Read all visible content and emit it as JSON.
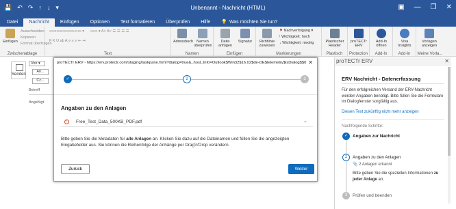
{
  "titlebar": {
    "title": "Unbenannt - Nachricht (HTML)",
    "qat": [
      "💾",
      "↶",
      "↷",
      "↑",
      "↓",
      "▾"
    ],
    "window_controls": [
      "▣",
      "—",
      "❐",
      "✕"
    ]
  },
  "tabs": [
    {
      "label": "Datei"
    },
    {
      "label": "Nachricht"
    },
    {
      "label": "Einfügen"
    },
    {
      "label": "Optionen"
    },
    {
      "label": "Text formatieren"
    },
    {
      "label": "Überprüfen"
    },
    {
      "label": "Hilfe"
    }
  ],
  "tell_me": "Was möchten Sie tun?",
  "ribbon": {
    "clipboard": {
      "paste": "Einfügen",
      "cut": "Ausschneiden",
      "copy": "Kopieren",
      "format": "Format übertragen",
      "label": "Zwischenablage"
    },
    "text_label": "Text",
    "names": {
      "addressbook": "Adressbuch",
      "check": "Namen überprüfen",
      "label": "Namen"
    },
    "include": {
      "attach": "Datei anfügen",
      "signature": "Signatur",
      "label": "Einfügen"
    },
    "tags": {
      "policy": "Richtlinie zuweisen",
      "followup": "Nachverfolgung",
      "high": "Wichtigkeit: hoch",
      "low": "Wichtigkeit: niedrig",
      "label": "Markierungen"
    },
    "addins": [
      {
        "label": "Plastischer Reader",
        "group": "Plastisch"
      },
      {
        "label": "proTECTr ERV",
        "group": "Protection"
      },
      {
        "label": "Add-In öffnen",
        "group": "Add-In"
      },
      {
        "label": "Viva Insights",
        "group": "Add-In"
      },
      {
        "label": "Vorlagen anzeigen",
        "group": "Meine Vorla..."
      }
    ]
  },
  "compose": {
    "send": "Senden",
    "from": "Von",
    "to": "An...",
    "cc": "Cc...",
    "subject": "Betreff",
    "attached": "Angefügt"
  },
  "dialog": {
    "title": "proTECTr ERV - https://erv.protectr.com/staging/taskpane.html?dialog=true&_host_Info=Outlook$Win32$16.02$de-DE$telemetry$isDialog$$0",
    "close": "✕",
    "steps": [
      {
        "label": "✓",
        "state": "done"
      },
      {
        "label": "2",
        "state": "current"
      },
      {
        "label": "3",
        "state": "todo"
      }
    ],
    "heading": "Angaben zu den Anlagen",
    "file": {
      "name": "Free_Test_Data_500KB_PDF.pdf",
      "icon": "warning-icon"
    },
    "desc_part1": "Bitte geben Sie die Metadaten für ",
    "desc_bold": "alle Anlagen",
    "desc_part2": " an. Klicken Sie dazu auf die Dateinamen und füllen Sie die angezeigten Eingabefelder aus. Sie können die Reihenfolge der Anhänge per Drag'n'Drop verändern.",
    "back": "Zurück",
    "next": "Weiter"
  },
  "pane": {
    "header": "proTECTr ERV",
    "close": "✕",
    "heading": "ERV Nachricht - Datenerfassung",
    "intro": "Für den erfolgreichen Versand der ERV-Nachricht werden Angaben benötigt. Bitte füllen Sie die Formulare im Dialogfenster sorgfältig aus.",
    "link": "Diesen Text zukünftig nicht mehr anzeigen",
    "next_steps": "Nachfolgende Schritte:",
    "steps": [
      {
        "label": "Angaben zur Nachricht",
        "state": "done",
        "marker": "✓"
      },
      {
        "label": "Angaben zu den Anlagen",
        "state": "current",
        "marker": "2"
      },
      {
        "label": "Prüfen und beenden",
        "state": "todo",
        "marker": "3"
      }
    ],
    "attachments_found": "2 Anlagen erkannt",
    "instruction_part1": "Bitte geben Sie die speziellen Informationen ",
    "instruction_bold": "zu jeder Anlage",
    "instruction_part2": " an."
  }
}
